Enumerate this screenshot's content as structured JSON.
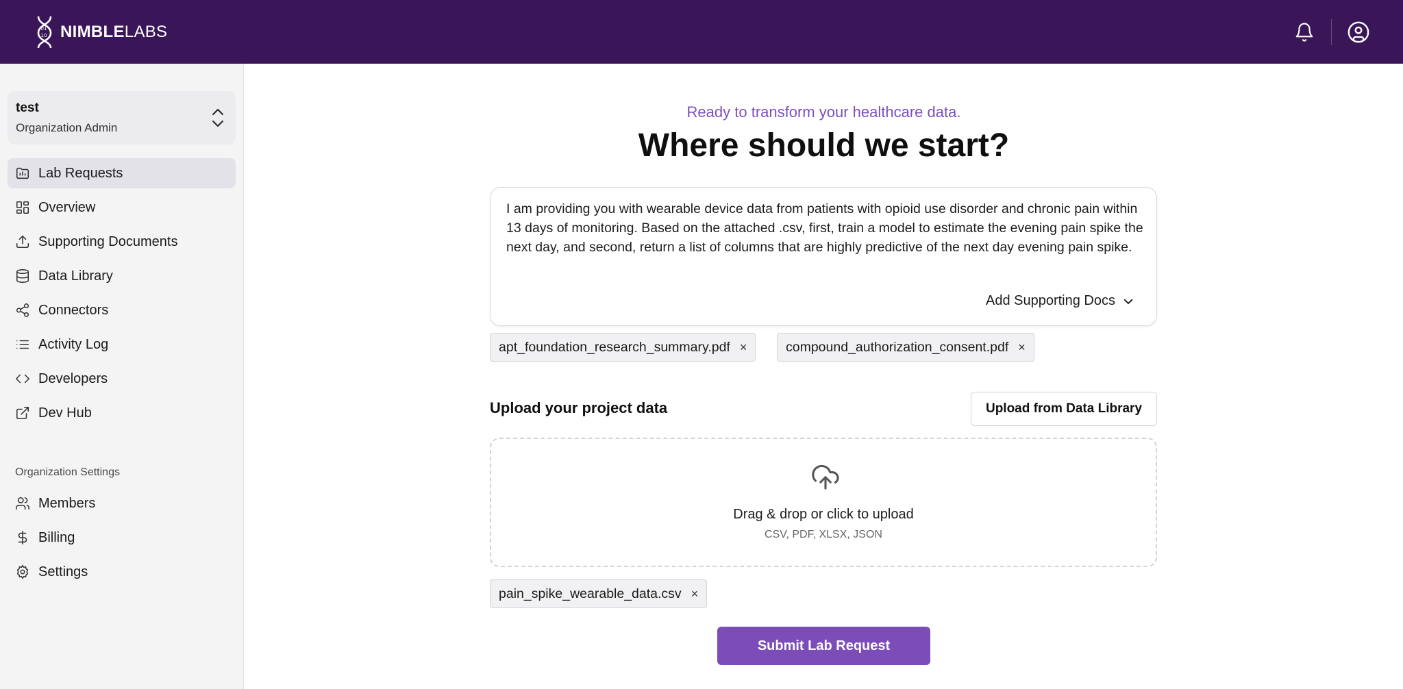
{
  "brand": {
    "name_bold": "NIMBLE",
    "name_light": "LABS"
  },
  "header": {
    "icons": [
      "bell-icon",
      "user-circle-icon"
    ]
  },
  "org": {
    "name": "test",
    "role": "Organization Admin"
  },
  "sidebar": {
    "items": [
      {
        "label": "Lab Requests",
        "icon": "folder-icon",
        "active": true
      },
      {
        "label": "Overview",
        "icon": "grid-icon"
      },
      {
        "label": "Supporting Documents",
        "icon": "upload-icon"
      },
      {
        "label": "Data Library",
        "icon": "database-icon"
      },
      {
        "label": "Connectors",
        "icon": "share-icon"
      },
      {
        "label": "Activity Log",
        "icon": "list-icon"
      },
      {
        "label": "Developers",
        "icon": "code-icon"
      },
      {
        "label": "Dev Hub",
        "icon": "external-link-icon"
      }
    ],
    "settings_section": "Organization Settings",
    "settings_items": [
      {
        "label": "Members",
        "icon": "users-icon"
      },
      {
        "label": "Billing",
        "icon": "dollar-icon"
      },
      {
        "label": "Settings",
        "icon": "gear-icon"
      }
    ]
  },
  "main": {
    "kicker": "Ready to transform your healthcare data.",
    "headline": "Where should we start?",
    "prompt_text": "I am providing you with wearable device data from patients with opioid use disorder and chronic pain within 13 days of monitoring. Based on the attached .csv, first, train a model to estimate the evening pain spike the next day, and second, return a list of columns that are highly predictive of the next day evening pain spike.",
    "add_docs_label": "Add Supporting Docs",
    "supporting_docs": [
      "apt_foundation_research_summary.pdf",
      "compound_authorization_consent.pdf"
    ],
    "upload_title": "Upload your project data",
    "library_button": "Upload from Data Library",
    "dropzone_main": "Drag & drop or click to upload",
    "dropzone_formats": "CSV, PDF, XLSX, JSON",
    "data_files": [
      "pain_spike_wearable_data.csv"
    ],
    "remove_symbol": "×",
    "submit_label": "Submit Lab Request"
  },
  "colors": {
    "topbar": "#3a1558",
    "accent": "#7c4db8",
    "kicker": "#7b4fbe"
  }
}
